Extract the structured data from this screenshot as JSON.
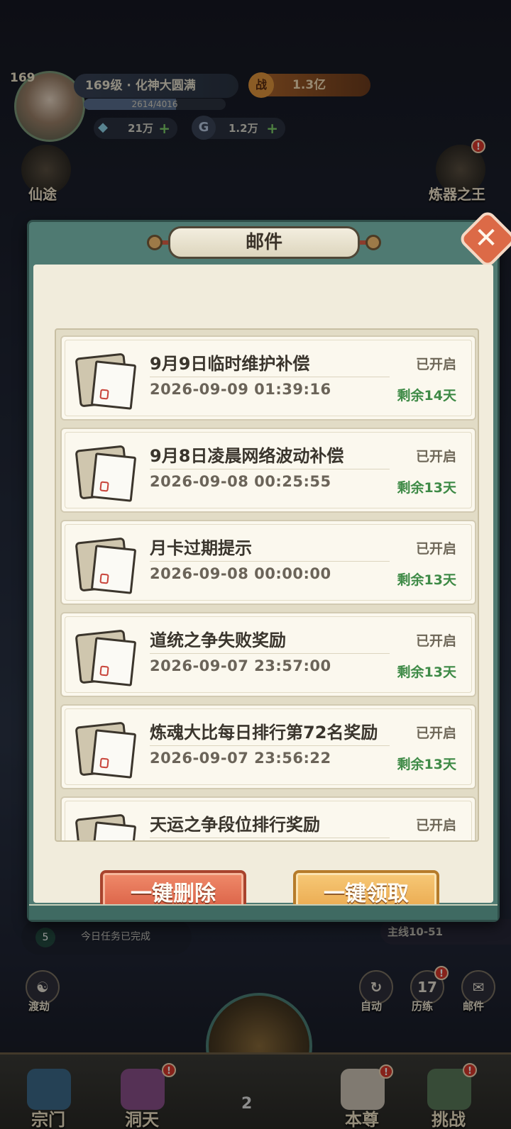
{
  "hud": {
    "avatar_level": "169",
    "realm": "169级 · 化神大圆满",
    "exp_text": "2614/4016",
    "exp_fraction": 0.65,
    "power_icon": "战",
    "power_value": "1.3亿",
    "spirit_stone": "21万",
    "currency2": "1.2万",
    "plus": "+"
  },
  "side_icons": {
    "left_top": "仙途",
    "right_top": "炼器之王"
  },
  "task": {
    "count": "5",
    "text": "今日任务已完成"
  },
  "stage": "主线10-51",
  "quick_buttons": {
    "dujie": "渡劫",
    "auto": "自动",
    "lilian": "历练",
    "lilian_count": "17",
    "mail": "邮件"
  },
  "bottom_nav": {
    "items": [
      "宗门",
      "洞天",
      "本尊",
      "挑战"
    ],
    "center_count": "2",
    "badge": "!"
  },
  "dialog": {
    "title": "邮件",
    "close": "✕",
    "mails": [
      {
        "title": "9月9日临时维护补偿",
        "time": "2026-09-09 01:39:16",
        "status": "已开启",
        "remain": "剩余14天"
      },
      {
        "title": "9月8日凌晨网络波动补偿",
        "time": "2026-09-08 00:25:55",
        "status": "已开启",
        "remain": "剩余13天"
      },
      {
        "title": "月卡过期提示",
        "time": "2026-09-08 00:00:00",
        "status": "已开启",
        "remain": "剩余13天"
      },
      {
        "title": "道统之争失败奖励",
        "time": "2026-09-07 23:57:00",
        "status": "已开启",
        "remain": "剩余13天"
      },
      {
        "title": "炼魂大比每日排行第72名奖励",
        "time": "2026-09-07 23:56:22",
        "status": "已开启",
        "remain": "剩余13天"
      },
      {
        "title": "天运之争段位排行奖励",
        "time": "",
        "status": "已开启",
        "remain": ""
      }
    ],
    "delete_all": "一键删除",
    "claim_all": "一键领取"
  }
}
